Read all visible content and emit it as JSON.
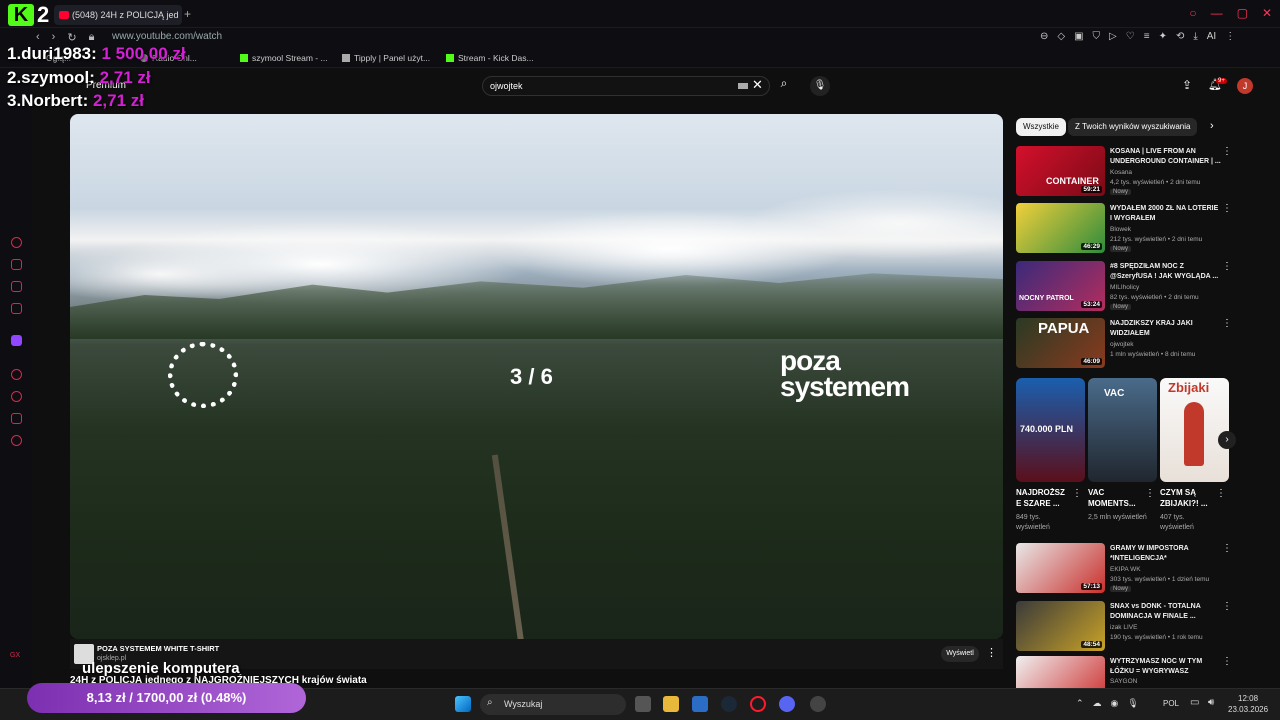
{
  "browser": {
    "tab_title": "(5048) 24H z POLICJĄ jed",
    "url": "www.youtube.com/watch",
    "bookmarks": [
      "Oglą...",
      "Radio Onl...",
      "szymool Stream - ...",
      "Tipply | Panel użyt...",
      "Stream - Kick Das..."
    ],
    "toolbar_ai": "AI"
  },
  "overlay": {
    "kick_number": "2",
    "leaderboard": [
      {
        "name": "1.duri1983:",
        "amount": "1 500,00 zł"
      },
      {
        "name": "2.szymool:",
        "amount": "2,71 zł"
      },
      {
        "name": "3.Norbert:",
        "amount": "2,71 zł"
      }
    ],
    "donation_goal": "8,13 zł / 1700,00 zł (0.48%)",
    "donation_progress": 0.0048
  },
  "youtube": {
    "premium_label": "Premium",
    "search_value": "ojwojtek",
    "notif_badge": "9+",
    "avatar_letter": "J",
    "video": {
      "slide_counter": "3 / 6",
      "logo_text_1": "poza",
      "logo_text_2": "systemem"
    },
    "sponsor": {
      "title": "POZA SYSTEMEM WHITE T-SHIRT",
      "site": "ojsklep.pl",
      "button": "Wyświetl"
    },
    "overlay_title_1": "ulepszenie komputera",
    "overlay_title_2": "24H z POLICJĄ jednego z NAJGROŹNIEJSZYCH krajów świata",
    "chips": [
      "Wszystkie",
      "Z Twoich wyników wyszukiwania"
    ],
    "recommendations": [
      {
        "title": "KOSANA | LIVE FROM AN UNDERGROUND CONTAINER | ...",
        "channel": "Kosana",
        "meta": "4,2 tys. wyświetleń • 2 dni temu",
        "badge": "Nowy",
        "duration": "59:21",
        "thumb": "CONTAINER"
      },
      {
        "title": "WYDAŁEM 2000 ZŁ NA LOTERIE I WYGRAŁEM",
        "channel": "Blowek",
        "meta": "212 tys. wyświetleń • 2 dni temu",
        "badge": "Nowy",
        "duration": "46:29",
        "thumb": ""
      },
      {
        "title": "#8 SPĘDZIŁAM NOC Z @SzeryfUSA ! JAK WYGLĄDA ...",
        "channel": "MILIholicy",
        "meta": "82 tys. wyświetleń • 2 dni temu",
        "badge": "Nowy",
        "duration": "53:24",
        "thumb": "NOCNY PATROL"
      },
      {
        "title": "NAJDZIKSZY KRAJ JAKI WIDZIAŁEM",
        "channel": "ojwojtek",
        "meta": "1 mln wyświetleń • 8 dni temu",
        "badge": "",
        "duration": "46:09",
        "thumb": "PAPUA"
      }
    ],
    "shorts": [
      {
        "title": "NAJDROŻSZ E SZARE ...",
        "views": "849 tys. wyświetleń",
        "thumb": "740.000 PLN"
      },
      {
        "title": "VAC MOMENTS...",
        "views": "2,5 mln wyświetleń",
        "thumb": "VAC"
      },
      {
        "title": "CZYM SĄ ZBIJAKI?! ...",
        "views": "407 tys. wyświetleń",
        "thumb": "Zbijaki"
      }
    ],
    "recommendations2": [
      {
        "title": "GRAMY W IMPOSTORA *INTELIGENCJA*",
        "channel": "EKIPA WK",
        "meta": "303 tys. wyświetleń • 1 dzień temu",
        "badge": "Nowy",
        "duration": "57:13"
      },
      {
        "title": "SNAX vs DONK - TOTALNA DOMINACJA W FINALE ...",
        "channel": "izak LIVE",
        "meta": "190 tys. wyświetleń • 1 rok temu",
        "badge": "",
        "duration": "48:54"
      },
      {
        "title": "WYTRZYMASZ NOC W TYM ŁÓŻKU = WYGRYWASZ",
        "channel": "SAYGON",
        "meta": "",
        "badge": "",
        "duration": ""
      }
    ]
  },
  "taskbar": {
    "search_placeholder": "Wyszukaj",
    "language": "POL",
    "time": "12:08",
    "date": "23.03.2026",
    "gx_label": "GX"
  }
}
